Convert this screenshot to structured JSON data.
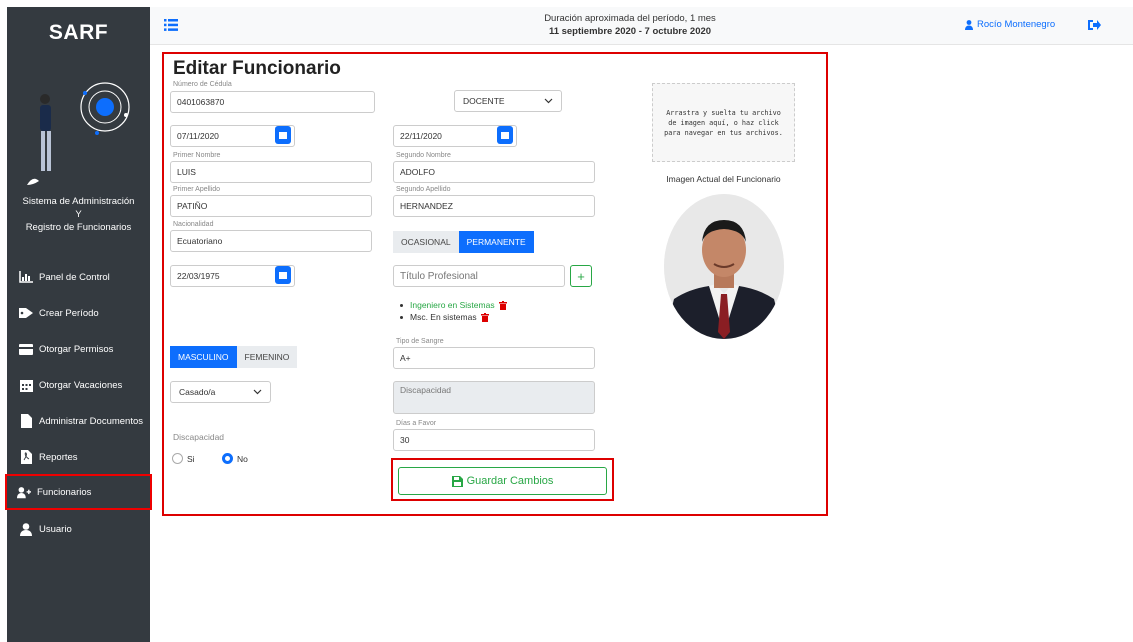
{
  "app": {
    "brand": "SARF",
    "caption_line1": "Sistema de Administración",
    "caption_line2": "Y",
    "caption_line3": "Registro de Funcionarios"
  },
  "sidebar": {
    "items": [
      {
        "label": "Panel de Control",
        "icon": "chart-icon"
      },
      {
        "label": "Crear Período",
        "icon": "tag-icon"
      },
      {
        "label": "Otorgar Permisos",
        "icon": "credit-card-icon"
      },
      {
        "label": "Otorgar Vacaciones",
        "icon": "calendar-icon"
      },
      {
        "label": "Administrar Documentos",
        "icon": "file-icon"
      },
      {
        "label": "Reportes",
        "icon": "pdf-icon"
      },
      {
        "label": "Funcionarios",
        "icon": "user-plus-icon",
        "active": true
      },
      {
        "label": "Usuario",
        "icon": "user-icon"
      }
    ]
  },
  "topbar": {
    "period_line1": "Duración aproximada del período, 1 mes",
    "period_line2": "11 septiembre 2020 - 7 octubre 2020",
    "user_name": "Rocío Montenegro"
  },
  "form": {
    "title": "Editar Funcionario",
    "cedula_label": "Número de Cédula",
    "cedula_value": "0401063870",
    "role_value": "DOCENTE",
    "date1_value": "07/11/2020",
    "date2_value": "22/11/2020",
    "first_name_label": "Primer Nombre",
    "first_name_value": "LUIS",
    "second_name_label": "Segundo Nombre",
    "second_name_value": "ADOLFO",
    "first_surname_label": "Primer Apellido",
    "first_surname_value": "PATIÑO",
    "second_surname_label": "Segundo Apellido",
    "second_surname_value": "HERNANDEZ",
    "nationality_label": "Nacionalidad",
    "nationality_value": "Ecuatoriano",
    "contract_options": [
      "OCASIONAL",
      "PERMANENTE"
    ],
    "contract_selected": "PERMANENTE",
    "birth_date_value": "22/03/1975",
    "degree_placeholder": "Título Profesional",
    "degrees": [
      "Ingeniero en Sistemas",
      "Msc. En sistemas"
    ],
    "gender_options": [
      "MASCULINO",
      "FEMENINO"
    ],
    "gender_selected": "MASCULINO",
    "blood_label": "Tipo de Sangre",
    "blood_value": "A+",
    "civil_value": "Casado/a",
    "disability_text_placeholder": "Discapacidad",
    "days_label": "Días a Favor",
    "days_value": "30",
    "disability_label": "Discapacidad",
    "disability_options": [
      "Si",
      "No"
    ],
    "disability_selected": "No",
    "save_label": "Guardar Cambios",
    "drop_text": "Arrastra y suelta tu archivo de imagen aquí, o haz click para navegar en tus archivos.",
    "image_label": "Imagen Actual del Funcionario"
  },
  "colors": {
    "sidebar": "#343a40",
    "primary": "#0d6efd",
    "success": "#28a745",
    "highlight": "#dd0000"
  }
}
